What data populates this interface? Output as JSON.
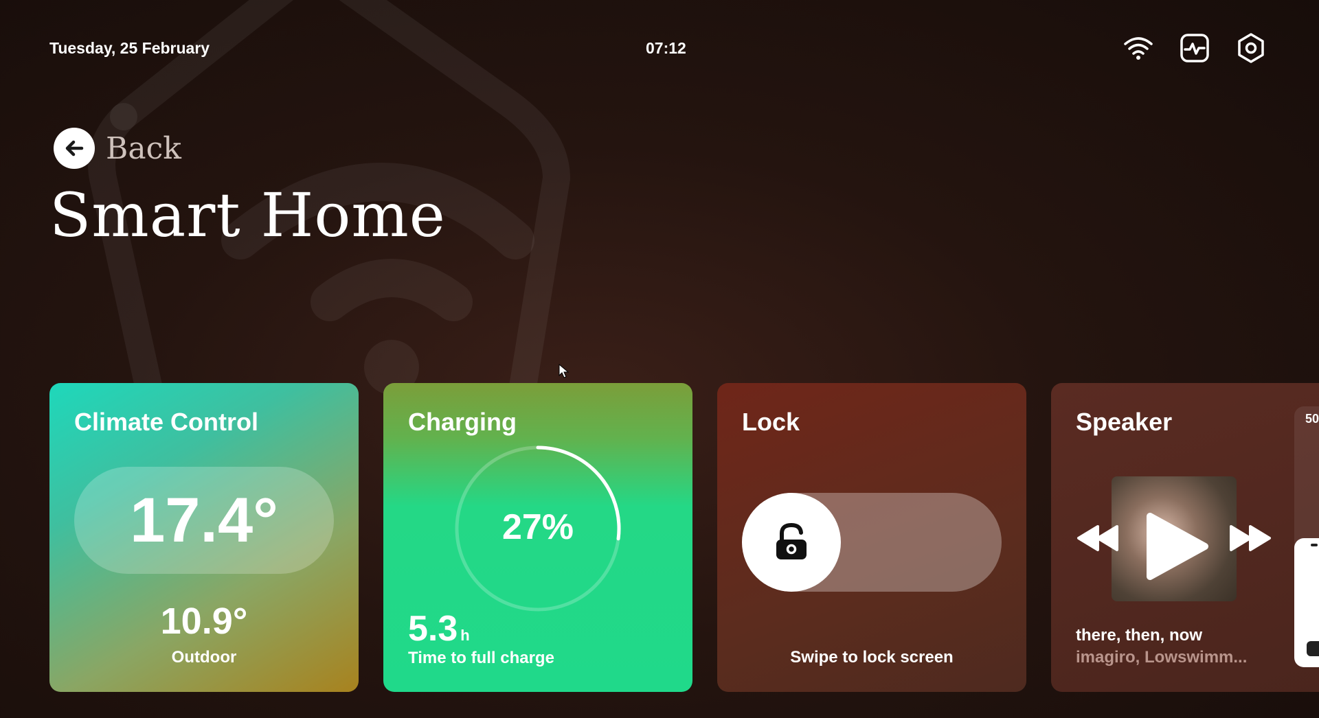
{
  "header": {
    "date": "Tuesday, 25 February",
    "time": "07:12",
    "icons": [
      "wifi-icon",
      "activity-monitor-icon",
      "settings-hexagon-icon"
    ]
  },
  "nav": {
    "back_label": "Back",
    "page_title": "Smart Home"
  },
  "cards": {
    "climate": {
      "title": "Climate Control",
      "indoor_temp": "17.4°",
      "outdoor_temp": "10.9°",
      "outdoor_label": "Outdoor"
    },
    "charging": {
      "title": "Charging",
      "percent": "27%",
      "percent_value": 27,
      "time_value": "5.3",
      "time_unit": "h",
      "time_label": "Time to full charge"
    },
    "lock": {
      "title": "Lock",
      "hint": "Swipe to lock screen"
    },
    "speaker": {
      "title": "Speaker",
      "song": "there, then, now",
      "artist": "imagiro, Lowswimm...",
      "volume_label": "50"
    }
  },
  "colors": {
    "background": "#1e110d",
    "climate_start": "#1ed8bb",
    "climate_end": "#a8821e",
    "charging": "#20d98a",
    "lock": "#6f2619",
    "speaker": "#4a251d"
  }
}
